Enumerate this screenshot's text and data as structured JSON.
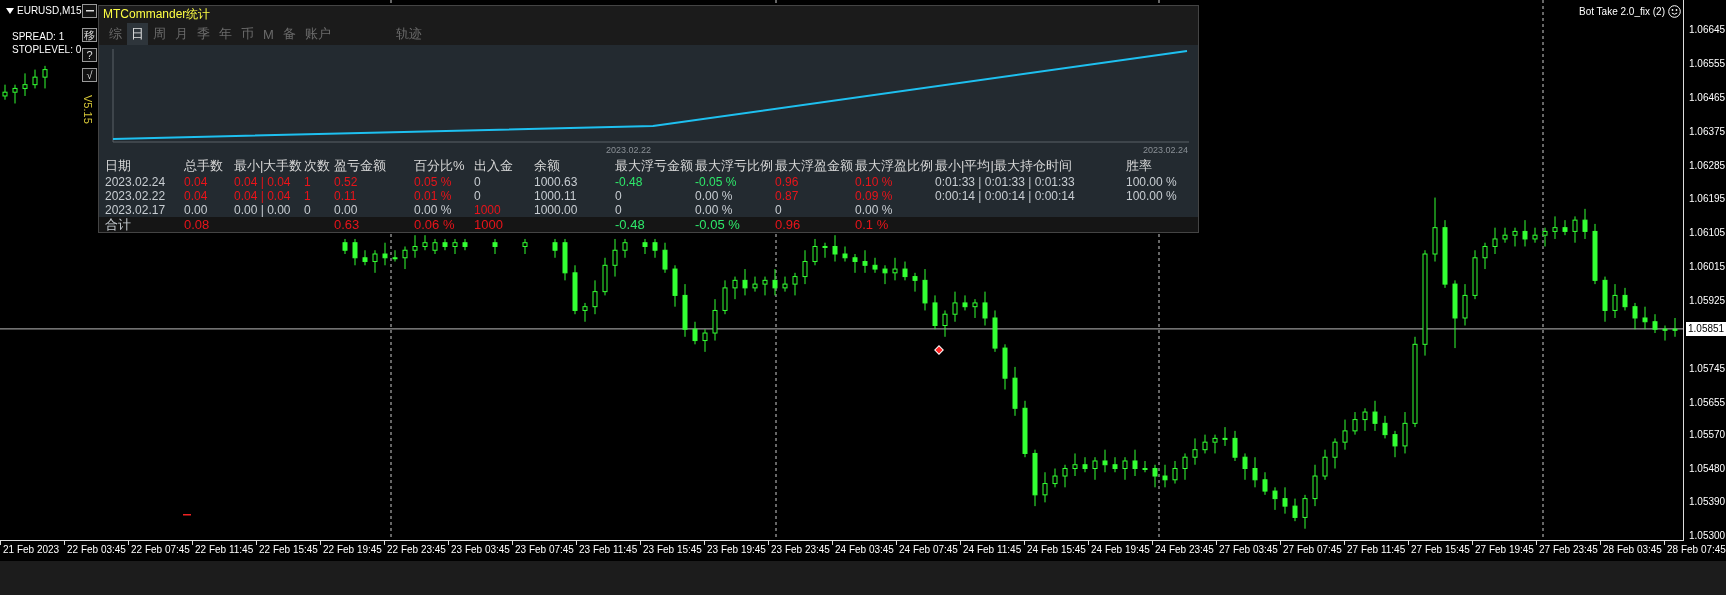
{
  "price_chart": {
    "chart_data": {
      "type": "candlestick",
      "ylim": [
        1.0529,
        1.06725
      ],
      "yticks": [
        {
          "value": 1.06645,
          "label": "1.06645"
        },
        {
          "value": 1.06555,
          "label": "1.06555"
        },
        {
          "value": 1.06465,
          "label": "1.06465"
        },
        {
          "value": 1.06375,
          "label": "1.06375"
        },
        {
          "value": 1.06285,
          "label": "1.06285"
        },
        {
          "value": 1.06195,
          "label": "1.06195"
        },
        {
          "value": 1.06105,
          "label": "1.06105"
        },
        {
          "value": 1.06015,
          "label": "1.06015"
        },
        {
          "value": 1.05925,
          "label": "1.05925"
        },
        {
          "value": 1.05745,
          "label": "1.05745"
        },
        {
          "value": 1.05655,
          "label": "1.05655"
        },
        {
          "value": 1.0557,
          "label": "1.05570"
        },
        {
          "value": 1.0548,
          "label": "1.05480"
        },
        {
          "value": 1.0539,
          "label": "1.05390"
        },
        {
          "value": 1.053,
          "label": "1.05300"
        }
      ],
      "ref_lines": [
        {
          "axis": "y",
          "value": 1.05851,
          "label": "1.05851"
        }
      ],
      "categories": [
        null,
        null,
        null,
        null,
        null,
        null,
        null,
        null,
        null,
        null,
        null,
        null,
        null,
        null,
        null,
        null,
        null,
        null,
        null,
        null,
        null,
        null,
        null,
        null,
        null,
        null,
        null,
        null,
        null,
        null,
        null,
        null,
        null,
        null,
        null,
        null,
        null,
        null,
        null,
        null,
        null,
        null,
        null,
        null,
        null,
        null,
        null,
        null,
        null,
        null,
        null,
        null,
        null,
        null,
        null,
        null,
        null,
        null,
        null,
        null,
        null,
        null,
        null,
        null,
        null,
        null,
        null,
        null,
        null,
        null,
        null,
        null,
        null,
        null,
        null,
        null,
        null,
        null,
        null,
        null,
        null,
        null,
        null,
        null,
        null,
        null,
        null,
        null,
        null,
        null,
        null,
        null,
        null,
        null,
        null,
        null,
        null,
        null,
        null,
        null,
        null,
        null,
        null,
        null,
        null,
        null,
        null,
        null,
        null,
        null,
        null,
        null,
        null,
        null,
        null,
        null,
        null,
        null,
        null,
        null,
        null,
        null,
        null,
        null,
        null,
        null,
        null,
        null,
        null,
        null,
        null,
        null,
        null,
        null,
        null,
        null,
        null,
        null,
        null,
        null,
        null,
        null,
        null,
        null,
        null,
        null,
        null,
        null,
        null,
        null,
        null,
        null,
        null,
        null,
        null,
        null,
        null,
        null,
        null,
        null,
        null,
        null,
        null,
        null,
        null,
        null,
        null,
        null
      ],
      "ohlc": [
        [
          1.0647,
          1.065,
          1.0646,
          1.0648
        ],
        [
          1.0648,
          1.065,
          1.0645,
          1.0649
        ],
        [
          1.0649,
          1.0653,
          1.0647,
          1.065
        ],
        [
          1.065,
          1.0654,
          1.0649,
          1.0652
        ],
        [
          1.0652,
          1.0655,
          1.0649,
          1.0654
        ],
        null,
        null,
        null,
        null,
        null,
        null,
        null,
        null,
        null,
        null,
        null,
        null,
        null,
        null,
        null,
        null,
        null,
        null,
        null,
        null,
        null,
        null,
        null,
        null,
        null,
        null,
        null,
        null,
        null,
        [
          1.0608,
          1.0609,
          1.0605,
          1.0606
        ],
        [
          1.0608,
          1.0609,
          1.0602,
          1.0604
        ],
        [
          1.0604,
          1.0606,
          1.0602,
          1.0603
        ],
        [
          1.0603,
          1.0606,
          1.06,
          1.0605
        ],
        [
          1.0605,
          1.0608,
          1.0602,
          1.0604
        ],
        [
          1.0604,
          1.0606,
          1.0603,
          1.0604
        ],
        [
          1.0604,
          1.0607,
          1.0601,
          1.0606
        ],
        [
          1.0606,
          1.061,
          1.0604,
          1.0607
        ],
        [
          1.0607,
          1.061,
          1.0606,
          1.0608
        ],
        [
          1.0606,
          1.0609,
          1.0605,
          1.0608
        ],
        [
          1.0608,
          1.0609,
          1.0606,
          1.0607
        ],
        [
          1.0607,
          1.0609,
          1.0605,
          1.0608
        ],
        [
          1.0608,
          1.0609,
          1.0606,
          1.0607
        ],
        null,
        null,
        [
          1.0608,
          1.0609,
          1.0605,
          1.0607
        ],
        null,
        null,
        [
          1.0607,
          1.0609,
          1.0605,
          1.0608
        ],
        null,
        null,
        [
          1.0608,
          1.0609,
          1.0604,
          1.0606
        ],
        [
          1.0608,
          1.0609,
          1.0598,
          1.06
        ],
        [
          1.06,
          1.0602,
          1.0589,
          1.059
        ],
        [
          1.059,
          1.0592,
          1.0587,
          1.0591
        ],
        [
          1.0591,
          1.0598,
          1.0589,
          1.0595
        ],
        [
          1.0595,
          1.0604,
          1.0594,
          1.0602
        ],
        [
          1.0602,
          1.0609,
          1.0599,
          1.0606
        ],
        [
          1.0606,
          1.0609,
          1.0604,
          1.0608
        ],
        null,
        [
          1.0608,
          1.0609,
          1.0605,
          1.0607
        ],
        [
          1.0608,
          1.0609,
          1.0604,
          1.0606
        ],
        [
          1.0606,
          1.0608,
          1.06,
          1.0601
        ],
        [
          1.0601,
          1.0602,
          1.0591,
          1.0594
        ],
        [
          1.0594,
          1.0597,
          1.0583,
          1.0585
        ],
        [
          1.0585,
          1.0587,
          1.0581,
          1.0582
        ],
        [
          1.0582,
          1.0585,
          1.0579,
          1.0584
        ],
        [
          1.0584,
          1.0593,
          1.0582,
          1.059
        ],
        [
          1.059,
          1.0598,
          1.0589,
          1.0596
        ],
        [
          1.0596,
          1.0599,
          1.0593,
          1.0598
        ],
        [
          1.0598,
          1.0601,
          1.0594,
          1.0596
        ],
        [
          1.0596,
          1.0599,
          1.0595,
          1.0597
        ],
        [
          1.0597,
          1.0599,
          1.0594,
          1.0598
        ],
        [
          1.0598,
          1.0601,
          1.0594,
          1.0596
        ],
        [
          1.0596,
          1.0599,
          1.0595,
          1.0597
        ],
        [
          1.0597,
          1.06,
          1.0594,
          1.0599
        ],
        [
          1.0599,
          1.0606,
          1.0597,
          1.0603
        ],
        [
          1.0603,
          1.0609,
          1.0602,
          1.0607
        ],
        [
          1.0607,
          1.0608,
          1.0604,
          1.0607
        ],
        [
          1.0607,
          1.061,
          1.0603,
          1.0605
        ],
        [
          1.0605,
          1.0607,
          1.0603,
          1.0604
        ],
        [
          1.0604,
          1.0605,
          1.06,
          1.0603
        ],
        [
          1.0603,
          1.0606,
          1.06,
          1.0602
        ],
        [
          1.0602,
          1.0604,
          1.06,
          1.0601
        ],
        [
          1.0601,
          1.0602,
          1.0597,
          1.06
        ],
        [
          1.06,
          1.0604,
          1.0598,
          1.0601
        ],
        [
          1.0601,
          1.0603,
          1.0598,
          1.0599
        ],
        [
          1.0599,
          1.06,
          1.0595,
          1.0598
        ],
        [
          1.0598,
          1.0601,
          1.059,
          1.0592
        ],
        [
          1.0592,
          1.0594,
          1.0585,
          1.0586
        ],
        [
          1.0586,
          1.059,
          1.0583,
          1.0589
        ],
        [
          1.0589,
          1.0595,
          1.0587,
          1.0592
        ],
        [
          1.0592,
          1.0594,
          1.059,
          1.0591
        ],
        [
          1.0591,
          1.0593,
          1.0588,
          1.0592
        ],
        [
          1.0592,
          1.0595,
          1.0586,
          1.0588
        ],
        [
          1.0588,
          1.059,
          1.0579,
          1.058
        ],
        [
          1.058,
          1.0581,
          1.0569,
          1.0572
        ],
        [
          1.0572,
          1.0575,
          1.0562,
          1.0564
        ],
        [
          1.0564,
          1.0566,
          1.0551,
          1.0552
        ],
        [
          1.0552,
          1.0553,
          1.0538,
          1.0541
        ],
        [
          1.0541,
          1.0547,
          1.0539,
          1.0544
        ],
        [
          1.0544,
          1.0548,
          1.0543,
          1.0546
        ],
        [
          1.0546,
          1.0549,
          1.0543,
          1.0548
        ],
        [
          1.0548,
          1.0552,
          1.0546,
          1.0549
        ],
        [
          1.0549,
          1.0551,
          1.0547,
          1.0548
        ],
        [
          1.0548,
          1.0551,
          1.0545,
          1.055
        ],
        [
          1.055,
          1.0553,
          1.0547,
          1.0549
        ],
        [
          1.0549,
          1.0551,
          1.0547,
          1.0548
        ],
        [
          1.0548,
          1.0551,
          1.0545,
          1.055
        ],
        [
          1.055,
          1.0553,
          1.0546,
          1.0548
        ],
        [
          1.0548,
          1.055,
          1.0547,
          1.0548
        ],
        [
          1.0548,
          1.0549,
          1.0543,
          1.0546
        ],
        [
          1.0546,
          1.0549,
          1.0543,
          1.0545
        ],
        [
          1.0545,
          1.055,
          1.0544,
          1.0548
        ],
        [
          1.0548,
          1.0552,
          1.0545,
          1.0551
        ],
        [
          1.0551,
          1.0556,
          1.0549,
          1.0553
        ],
        [
          1.0553,
          1.0557,
          1.0552,
          1.0555
        ],
        [
          1.0555,
          1.0557,
          1.0552,
          1.0556
        ],
        [
          1.0556,
          1.0559,
          1.0554,
          1.0556
        ],
        [
          1.0556,
          1.0558,
          1.055,
          1.0551
        ],
        [
          1.0551,
          1.0552,
          1.0545,
          1.0548
        ],
        [
          1.0548,
          1.0551,
          1.0543,
          1.0545
        ],
        [
          1.0545,
          1.0547,
          1.0541,
          1.0542
        ],
        [
          1.0542,
          1.0543,
          1.0537,
          1.054
        ],
        [
          1.054,
          1.0543,
          1.0536,
          1.0538
        ],
        [
          1.0538,
          1.054,
          1.0534,
          1.0535
        ],
        [
          1.0535,
          1.0541,
          1.0532,
          1.054
        ],
        [
          1.054,
          1.0549,
          1.0538,
          1.0546
        ],
        [
          1.0546,
          1.0553,
          1.0545,
          1.0551
        ],
        [
          1.0551,
          1.0556,
          1.0548,
          1.0555
        ],
        [
          1.0555,
          1.0561,
          1.0553,
          1.0558
        ],
        [
          1.0558,
          1.0563,
          1.0557,
          1.0561
        ],
        [
          1.0561,
          1.0564,
          1.0558,
          1.0563
        ],
        [
          1.0563,
          1.0566,
          1.0558,
          1.056
        ],
        [
          1.056,
          1.0562,
          1.0556,
          1.0557
        ],
        [
          1.0557,
          1.0558,
          1.0551,
          1.0554
        ],
        [
          1.0554,
          1.0563,
          1.0552,
          1.056
        ],
        [
          1.056,
          1.0583,
          1.0559,
          1.0581
        ],
        [
          1.0581,
          1.0606,
          1.0578,
          1.0605
        ],
        [
          1.0605,
          1.062,
          1.0603,
          1.0612
        ],
        [
          1.0612,
          1.0614,
          1.0596,
          1.0597
        ],
        [
          1.0597,
          1.0598,
          1.058,
          1.0588
        ],
        [
          1.0588,
          1.0597,
          1.0586,
          1.0594
        ],
        [
          1.0594,
          1.0606,
          1.0593,
          1.0604
        ],
        [
          1.0604,
          1.0608,
          1.0601,
          1.0607
        ],
        [
          1.0607,
          1.0612,
          1.0605,
          1.0609
        ],
        [
          1.0609,
          1.0612,
          1.0608,
          1.061
        ],
        [
          1.061,
          1.0612,
          1.0607,
          1.0611
        ],
        [
          1.0611,
          1.0614,
          1.0607,
          1.0609
        ],
        [
          1.0609,
          1.0612,
          1.0608,
          1.061
        ],
        [
          1.061,
          1.0612,
          1.0607,
          1.0611
        ],
        [
          1.0611,
          1.0615,
          1.0609,
          1.0612
        ],
        [
          1.0612,
          1.0614,
          1.061,
          1.0611
        ],
        [
          1.0611,
          1.0615,
          1.0608,
          1.0614
        ],
        [
          1.0614,
          1.0617,
          1.0609,
          1.0611
        ],
        [
          1.0611,
          1.0613,
          1.0597,
          1.0598
        ],
        [
          1.0598,
          1.0599,
          1.0587,
          1.059
        ],
        [
          1.059,
          1.0597,
          1.0588,
          1.0594
        ],
        [
          1.0594,
          1.0596,
          1.059,
          1.0591
        ],
        [
          1.0591,
          1.0592,
          1.0585,
          1.0588
        ],
        [
          1.0588,
          1.0591,
          1.0585,
          1.0587
        ],
        [
          1.0587,
          1.0589,
          1.0584,
          1.0585
        ],
        [
          1.0585,
          1.0586,
          1.0582,
          1.0585
        ],
        [
          1.0585,
          1.0588,
          1.0583,
          1.0585
        ]
      ]
    }
  },
  "symbol": {
    "title": "EURUSD,M15"
  },
  "info": [
    "SPREAD: 1",
    "STOPLEVEL: 0"
  ],
  "side_buttons": [
    "移",
    "?",
    "√"
  ],
  "version": "V5.15",
  "expert": {
    "name": "Bot Take 2.0_fix (2)"
  },
  "panel": {
    "title": "MTCommander统计",
    "tabs": [
      {
        "label": "综",
        "selected": false
      },
      {
        "label": "日",
        "selected": true
      },
      {
        "label": "周",
        "selected": false
      },
      {
        "label": "月",
        "selected": false
      },
      {
        "label": "季",
        "selected": false
      },
      {
        "label": "年",
        "selected": false
      },
      {
        "label": "币",
        "selected": false
      },
      {
        "label": "M",
        "selected": false
      },
      {
        "label": "备",
        "selected": false
      },
      {
        "label": "账户",
        "selected": false
      }
    ],
    "trace_tab": {
      "label": "轨迹",
      "selected": false
    },
    "chart": {
      "x_labels": [
        "2023.02.22",
        "2023.02.24"
      ]
    },
    "table": {
      "columns": [
        "日期",
        "总手数",
        "最小|大手数",
        "次数",
        "盈亏金额",
        "百分比%",
        "出入金",
        "余额",
        "最大浮亏金额",
        "最大浮亏比例",
        "最大浮盈金额",
        "最大浮盈比例",
        "最小|平均|最大持仓时间",
        "胜率"
      ],
      "rows": [
        {
          "cells": [
            {
              "text": "2023.02.24",
              "color": "#c8cdd2"
            },
            {
              "text": "0.04",
              "color": "#e8141a"
            },
            {
              "text": "0.04 | 0.04",
              "color": "#e8141a"
            },
            {
              "text": "1",
              "color": "#e8141a"
            },
            {
              "text": "0.52",
              "color": "#e8141a"
            },
            {
              "text": "0.05 %",
              "color": "#e8141a"
            },
            {
              "text": "0",
              "color": "#c8cdd2"
            },
            {
              "text": "1000.63",
              "color": "#c8cdd2"
            },
            {
              "text": "-0.48",
              "color": "#2ee86a"
            },
            {
              "text": "-0.05 %",
              "color": "#2ee86a"
            },
            {
              "text": "0.96",
              "color": "#e8141a"
            },
            {
              "text": "0.10 %",
              "color": "#e8141a"
            },
            {
              "text": "0:01:33 | 0:01:33 | 0:01:33",
              "color": "#c8cdd2"
            },
            {
              "text": "100.00 %",
              "color": "#c8cdd2"
            }
          ]
        },
        {
          "cells": [
            {
              "text": "2023.02.22",
              "color": "#c8cdd2"
            },
            {
              "text": "0.04",
              "color": "#e8141a"
            },
            {
              "text": "0.04 | 0.04",
              "color": "#e8141a"
            },
            {
              "text": "1",
              "color": "#e8141a"
            },
            {
              "text": "0.11",
              "color": "#e8141a"
            },
            {
              "text": "0.01 %",
              "color": "#e8141a"
            },
            {
              "text": "0",
              "color": "#c8cdd2"
            },
            {
              "text": "1000.11",
              "color": "#c8cdd2"
            },
            {
              "text": "0",
              "color": "#c8cdd2"
            },
            {
              "text": "0.00 %",
              "color": "#c8cdd2"
            },
            {
              "text": "0.87",
              "color": "#e8141a"
            },
            {
              "text": "0.09 %",
              "color": "#e8141a"
            },
            {
              "text": "0:00:14 | 0:00:14 | 0:00:14",
              "color": "#c8cdd2"
            },
            {
              "text": "100.00 %",
              "color": "#c8cdd2"
            }
          ]
        },
        {
          "cells": [
            {
              "text": "2023.02.17",
              "color": "#c8cdd2"
            },
            {
              "text": "0.00",
              "color": "#c8cdd2"
            },
            {
              "text": "0.00 | 0.00",
              "color": "#c8cdd2"
            },
            {
              "text": "0",
              "color": "#c8cdd2"
            },
            {
              "text": "0.00",
              "color": "#c8cdd2"
            },
            {
              "text": "0.00 %",
              "color": "#c8cdd2"
            },
            {
              "text": "1000",
              "color": "#e8141a"
            },
            {
              "text": "1000.00",
              "color": "#c8cdd2"
            },
            {
              "text": "0",
              "color": "#c8cdd2"
            },
            {
              "text": "0.00 %",
              "color": "#c8cdd2"
            },
            {
              "text": "0",
              "color": "#c8cdd2"
            },
            {
              "text": "0.00 %",
              "color": "#c8cdd2"
            },
            null,
            null
          ]
        }
      ],
      "total": {
        "cells": [
          {
            "text": "合计",
            "color": "#c8cdd2"
          },
          {
            "text": "0.08",
            "color": "#e8141a"
          },
          null,
          null,
          {
            "text": "0.63",
            "color": "#e8141a"
          },
          {
            "text": "0.06 %",
            "color": "#e8141a"
          },
          {
            "text": "1000",
            "color": "#e8141a"
          },
          null,
          {
            "text": "-0.48",
            "color": "#2ee86a"
          },
          {
            "text": "-0.05 %",
            "color": "#2ee86a"
          },
          {
            "text": "0.96",
            "color": "#e8141a"
          },
          {
            "text": "0.1 %",
            "color": "#e8141a"
          },
          null,
          null
        ]
      }
    }
  },
  "time_axis": [
    "21 Feb 2023",
    "22 Feb 03:45",
    "22 Feb 07:45",
    "22 Feb 11:45",
    "22 Feb 15:45",
    "22 Feb 19:45",
    "22 Feb 23:45",
    "23 Feb 03:45",
    "23 Feb 07:45",
    "23 Feb 11:45",
    "23 Feb 15:45",
    "23 Feb 19:45",
    "23 Feb 23:45",
    "24 Feb 03:45",
    "24 Feb 07:45",
    "24 Feb 11:45",
    "24 Feb 15:45",
    "24 Feb 19:45",
    "24 Feb 23:45",
    "27 Feb 03:45",
    "27 Feb 07:45",
    "27 Feb 11:45",
    "27 Feb 15:45",
    "27 Feb 19:45",
    "27 Feb 23:45",
    "28 Feb 03:45",
    "28 Feb 07:45"
  ]
}
